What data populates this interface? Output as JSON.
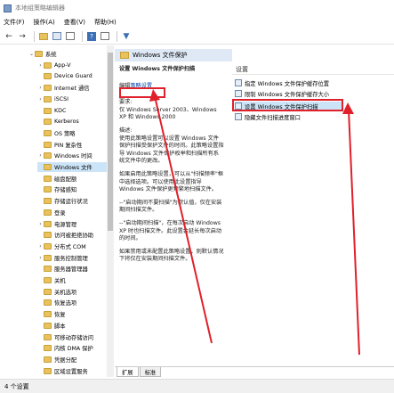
{
  "window": {
    "title": "本地组策略编辑器"
  },
  "menu": [
    "文件(F)",
    "操作(A)",
    "查看(V)",
    "帮助(H)"
  ],
  "toolbar": {
    "icons": [
      "back-icon",
      "forward-icon",
      "folder-icon",
      "list-icon",
      "refresh-icon",
      "help-icon",
      "properties-icon",
      "filter-icon"
    ]
  },
  "tree": {
    "items": [
      {
        "label": "系统",
        "caret": "v",
        "indent": 0
      },
      {
        "label": "App-V",
        "caret": ">",
        "indent": 1
      },
      {
        "label": "Device Guard",
        "caret": "",
        "indent": 1
      },
      {
        "label": "Internet 通信",
        "caret": ">",
        "indent": 1
      },
      {
        "label": "iSCSI",
        "caret": ">",
        "indent": 1
      },
      {
        "label": "KDC",
        "caret": "",
        "indent": 1
      },
      {
        "label": "Kerberos",
        "caret": "",
        "indent": 1
      },
      {
        "label": "OS 策略",
        "caret": "",
        "indent": 1
      },
      {
        "label": "PIN 复杂性",
        "caret": "",
        "indent": 1
      },
      {
        "label": "Windows 时间",
        "caret": ">",
        "indent": 1
      },
      {
        "label": "Windows 文件",
        "caret": "",
        "indent": 1,
        "selected": true
      },
      {
        "label": "磁盘配额",
        "caret": "",
        "indent": 1
      },
      {
        "label": "存储感知",
        "caret": "",
        "indent": 1
      },
      {
        "label": "存储运行状况",
        "caret": "",
        "indent": 1
      },
      {
        "label": "登录",
        "caret": "",
        "indent": 1
      },
      {
        "label": "电源管理",
        "caret": ">",
        "indent": 1
      },
      {
        "label": "访问被拒绝协助",
        "caret": "",
        "indent": 1
      },
      {
        "label": "分布式 COM",
        "caret": ">",
        "indent": 1
      },
      {
        "label": "服务控制管理",
        "caret": ">",
        "indent": 1
      },
      {
        "label": "服务器管理器",
        "caret": "",
        "indent": 1
      },
      {
        "label": "关机",
        "caret": "",
        "indent": 1
      },
      {
        "label": "关机选项",
        "caret": "",
        "indent": 1
      },
      {
        "label": "恢复选项",
        "caret": "",
        "indent": 1
      },
      {
        "label": "恢复",
        "caret": "",
        "indent": 1
      },
      {
        "label": "脚本",
        "caret": "",
        "indent": 1
      },
      {
        "label": "可移动存储访问",
        "caret": "",
        "indent": 1
      },
      {
        "label": "内核 DMA 保护",
        "caret": "",
        "indent": 1
      },
      {
        "label": "凭据分配",
        "caret": "",
        "indent": 1
      },
      {
        "label": "区域设置服务",
        "caret": "",
        "indent": 1
      }
    ]
  },
  "description": {
    "header": "Windows 文件保护",
    "setting_title": "设置 Windows 文件保护扫描",
    "edit_prefix": "编辑",
    "edit_link": "策略设置",
    "requirements": "要求:\n仅 Windows Server 2003、Windows XP 和 Windows 2000",
    "desc_label": "描述:",
    "paragraphs": [
      "使用此策略设置可以设置 Windows 文件保护扫描受保护文件的时间。此策略设置指导 Windows 文件保护枚举和扫描所有系统文件中的更改。",
      "如果启用此策略设置，可以从\"扫描频率\"框中选择选项。可以使用此设置指导 Windows 文件保护更频繁地扫描文件。",
      "--\"启动期间不要扫描\"为默认值，仅在安装期间扫描文件。",
      "--\"启动期间扫描\"，在每次启动 Windows XP 时也扫描文件。此设置会延长每次启动的时间。",
      "如果禁用或未配置此策略设置，则默认情况下将仅在安装期间扫描文件。"
    ]
  },
  "settings": {
    "column_header": "设置",
    "items": [
      {
        "label": "指定 Windows 文件保护缓存位置"
      },
      {
        "label": "限制 Windows 文件保护缓存大小"
      },
      {
        "label": "设置 Windows 文件保护扫描",
        "selected": true
      },
      {
        "label": "隐藏文件扫描进度窗口"
      }
    ]
  },
  "tabs": [
    "扩展",
    "标准"
  ],
  "status": "4 个设置",
  "colors": {
    "highlight": "#cce4f7",
    "annotation_red": "#e0202a",
    "header_blue": "#dfe9f5"
  }
}
